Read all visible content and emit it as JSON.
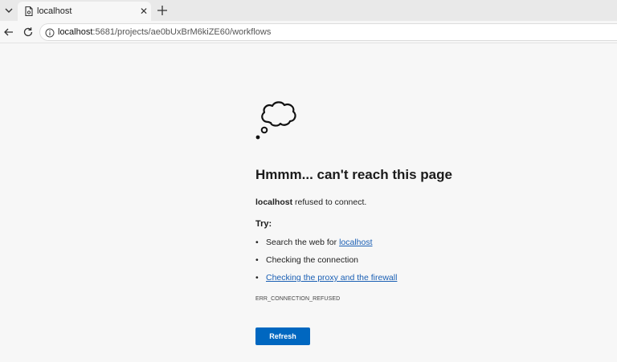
{
  "tabs": [
    {
      "title": "localhost",
      "favicon": "document-broken-icon",
      "active": true
    }
  ],
  "toolbar": {
    "url_host": "localhost",
    "url_path": ":5681/projects/ae0bUxBrM6kiZE60/workflows"
  },
  "error_page": {
    "icon": "thought-cloud-icon",
    "heading": "Hmmm... can't reach this page",
    "host": "localhost",
    "message_suffix": " refused to connect.",
    "try_label": "Try:",
    "suggestions": [
      {
        "text": "Search the web for ",
        "link": "localhost"
      },
      {
        "text": "Checking the connection"
      },
      {
        "link": "Checking the proxy and the firewall"
      }
    ],
    "error_code": "ERR_CONNECTION_REFUSED",
    "refresh_label": "Refresh"
  },
  "colors": {
    "accent_button": "#0067c0",
    "link": "#1a5fb4",
    "page_background": "#f7f7f7",
    "tabstrip_background": "#e9e9e9"
  }
}
